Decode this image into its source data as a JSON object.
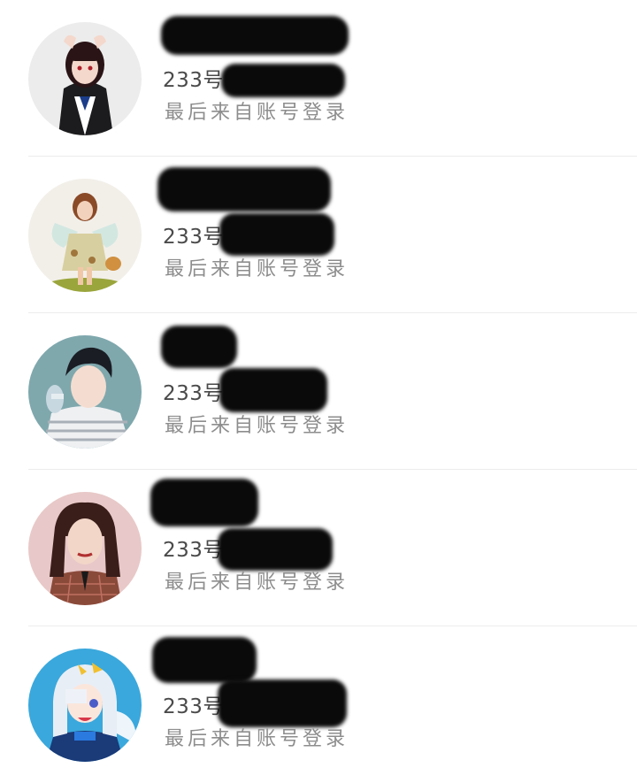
{
  "accounts": [
    {
      "id_prefix": "233号",
      "last_login": "最后来自账号登录"
    },
    {
      "id_prefix": "233号",
      "last_login": "最后来自账号登录"
    },
    {
      "id_prefix": "233号",
      "last_login": "最后来自账号登录"
    },
    {
      "id_prefix": "233号",
      "last_login": "最后来自账号登录"
    },
    {
      "id_prefix": "233号",
      "last_login": "最后来自账号登录"
    }
  ],
  "colors": {
    "background": "#ffffff",
    "divider": "#ececec",
    "id_text": "#4a4a4a",
    "secondary_text": "#8d8d8d",
    "redaction": "#0a0a0a"
  }
}
